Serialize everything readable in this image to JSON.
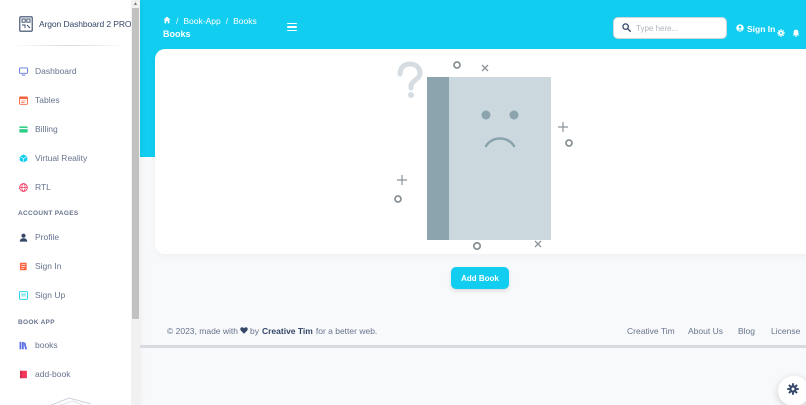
{
  "sidebar": {
    "brand": "Argon Dashboard 2 PRO",
    "items": [
      {
        "label": "Dashboard",
        "icon": "monitor-icon"
      },
      {
        "label": "Tables",
        "icon": "calendar-icon"
      },
      {
        "label": "Billing",
        "icon": "credit-card-icon"
      },
      {
        "label": "Virtual Reality",
        "icon": "box-icon"
      },
      {
        "label": "RTL",
        "icon": "globe-icon"
      }
    ],
    "account_heading": "ACCOUNT PAGES",
    "account_items": [
      {
        "label": "Profile",
        "icon": "user-icon"
      },
      {
        "label": "Sign In",
        "icon": "document-icon"
      },
      {
        "label": "Sign Up",
        "icon": "collection-icon"
      }
    ],
    "book_heading": "BOOK APP",
    "book_items": [
      {
        "label": "books",
        "icon": "books-icon"
      },
      {
        "label": "add-book",
        "icon": "book-icon"
      }
    ]
  },
  "header": {
    "breadcrumb": [
      "Book-App",
      "Books"
    ],
    "title": "Books",
    "search_placeholder": "Type here...",
    "signin_label": "Sign In"
  },
  "main": {
    "add_button": "Add Book"
  },
  "footer": {
    "copyright_prefix": "© 2023, made with",
    "by": "by",
    "author": "Creative Tim",
    "suffix": "for a better web.",
    "links": [
      "Creative Tim",
      "About Us",
      "Blog",
      "License"
    ]
  },
  "colors": {
    "primary": "#11cdef",
    "text": "#344767",
    "muted": "#67748e"
  }
}
